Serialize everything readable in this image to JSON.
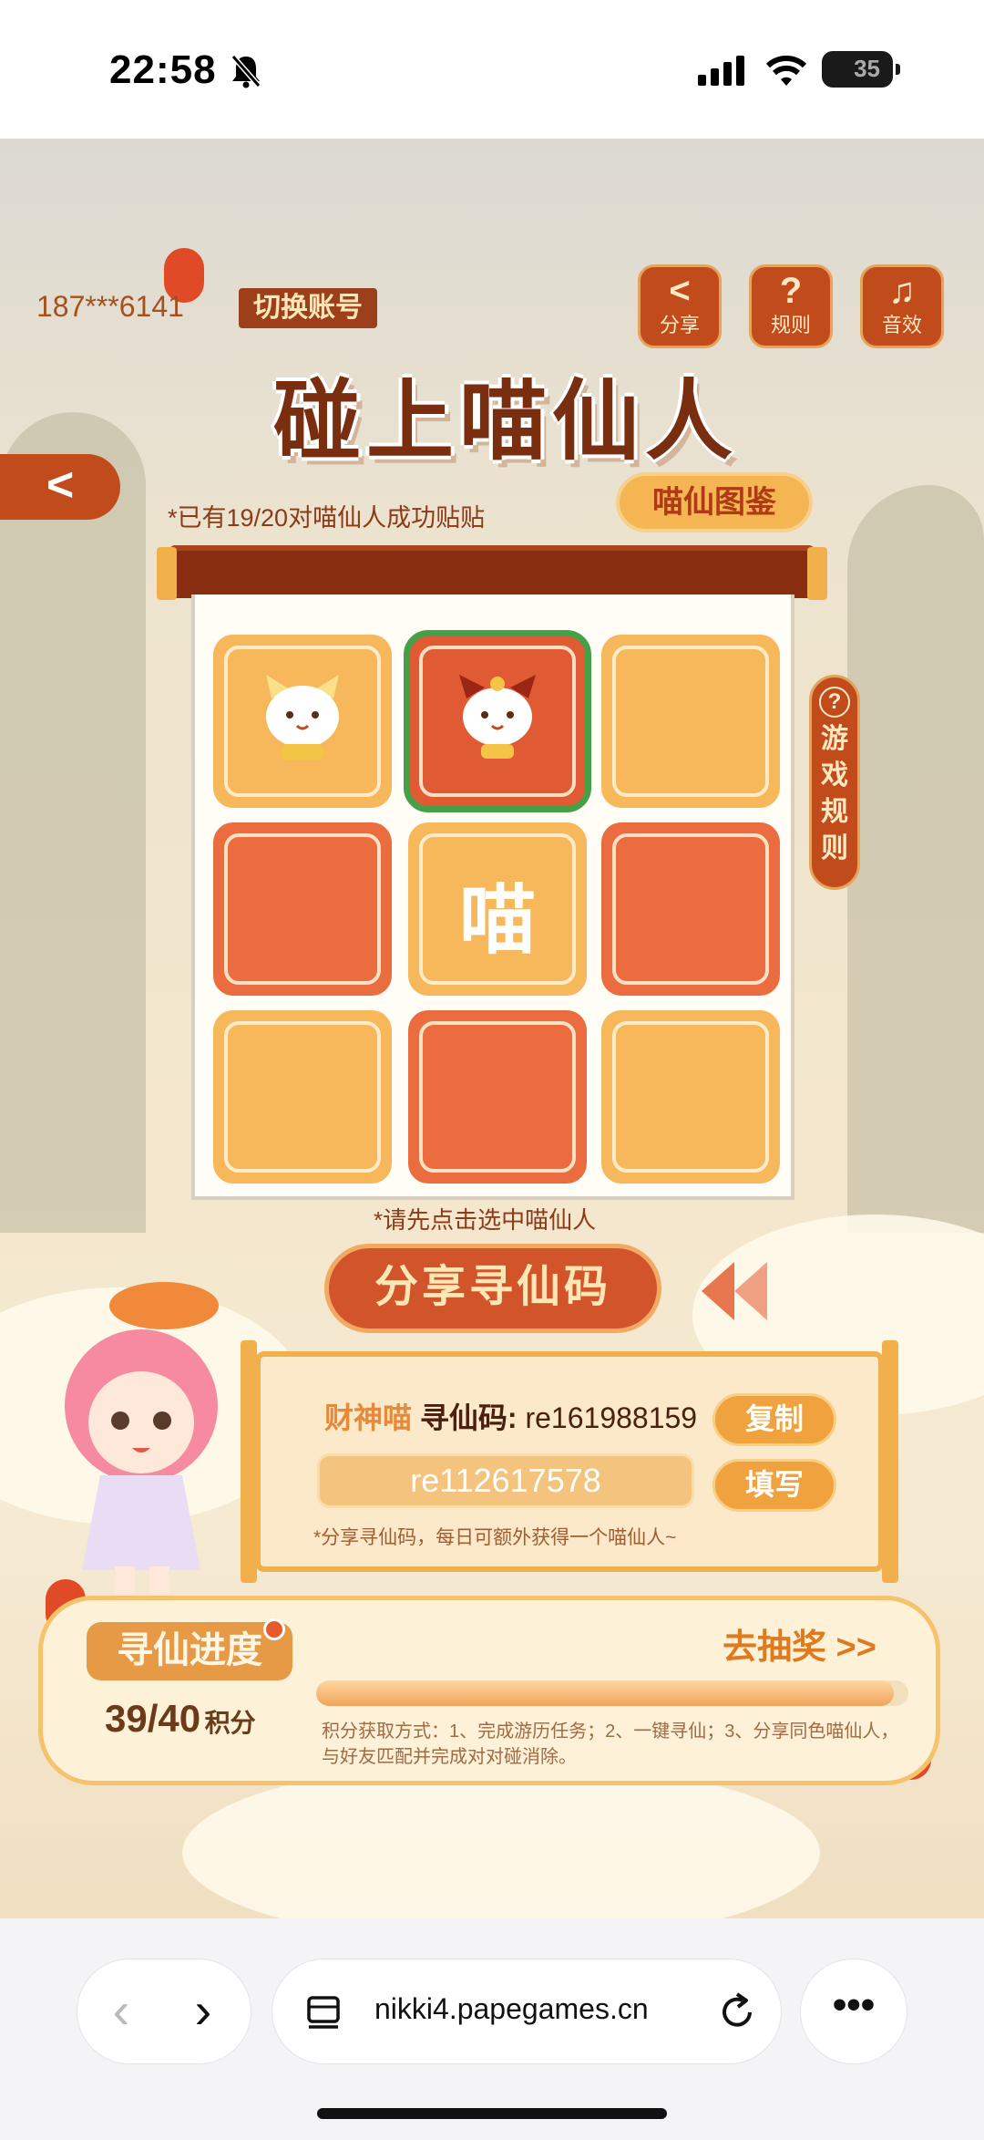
{
  "status_bar": {
    "time": "22:58",
    "battery": "35"
  },
  "header": {
    "account": "187***6141",
    "switch_account": "切换账号",
    "icons": [
      {
        "icon": "share-icon",
        "label": "分享"
      },
      {
        "icon": "rules-icon",
        "label": "规则"
      },
      {
        "icon": "sound-icon",
        "label": "音效"
      }
    ],
    "title": "碰上喵仙人"
  },
  "board": {
    "paired_text": "*已有19/20对喵仙人成功贴贴",
    "codex_button": "喵仙图鉴",
    "side_rules": "游戏规则",
    "tiles": [
      {
        "color": "gold",
        "content": "cat-gold"
      },
      {
        "color": "red",
        "content": "cat-red",
        "selected": true
      },
      {
        "color": "gold",
        "content": ""
      },
      {
        "color": "red",
        "content": ""
      },
      {
        "color": "gold",
        "content": "喵"
      },
      {
        "color": "red",
        "content": ""
      },
      {
        "color": "gold",
        "content": ""
      },
      {
        "color": "red",
        "content": ""
      },
      {
        "color": "gold",
        "content": ""
      }
    ],
    "select_hint": "*请先点击选中喵仙人",
    "share_code_button": "分享寻仙码"
  },
  "code_panel": {
    "name": "财神喵",
    "code_key": "寻仙码",
    "code_value": "re161988159",
    "input_value": "re112617578",
    "copy_button": "复制",
    "fill_button": "填写",
    "hint": "*分享寻仙码，每日可额外获得一个喵仙人~"
  },
  "progress": {
    "title": "寻仙进度",
    "score": "39/40",
    "score_unit": "积分",
    "fraction": 0.975,
    "lottery_link": "去抽奖 >>",
    "ways": "积分获取方式：1、完成游历任务；2、一键寻仙；3、分享同色喵仙人，与好友匹配并完成对对碰消除。"
  },
  "browser": {
    "url": "nikki4.papegames.cn"
  },
  "colors": {
    "accent_red": "#c24b1c",
    "tile_gold": "#f6b85a",
    "tile_red": "#ea6c3f",
    "selected_border": "#45a047"
  }
}
